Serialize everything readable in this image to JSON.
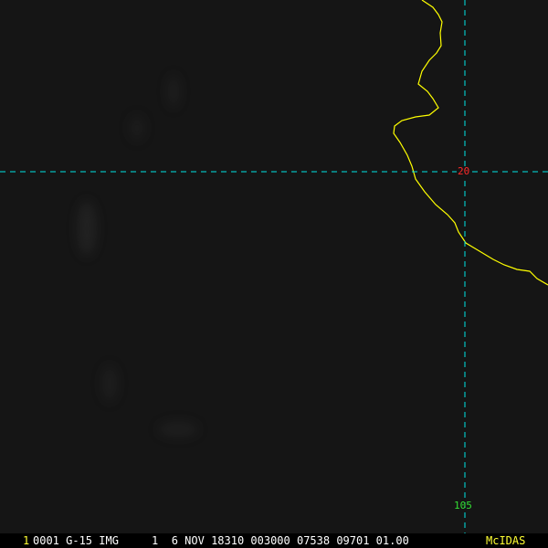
{
  "map": {
    "background_color": "#151515",
    "coastline_color": "#ffff00",
    "grid_color": "#00e5e5",
    "grid_line_style": "dashed"
  },
  "labels": {
    "latitude": "20",
    "longitude": "105"
  },
  "status_bar": {
    "frame_number": "1",
    "text": "0001 G-15 IMG     1  6 NOV 18310 003000 07538 09701 01.00",
    "brand": "McIDAS"
  }
}
